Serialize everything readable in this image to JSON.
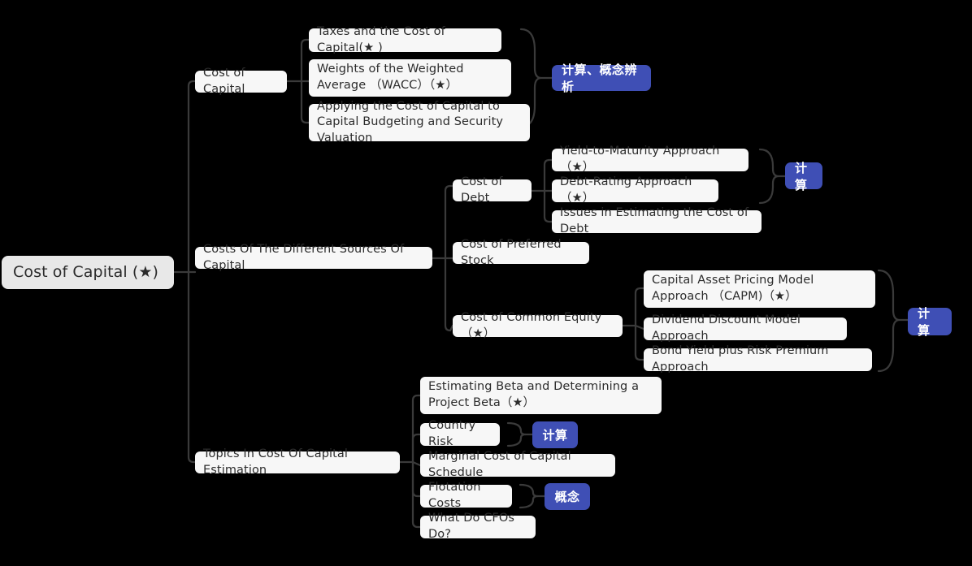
{
  "theme": {
    "background": "#000000",
    "node_bg": "#f7f7f7",
    "root_bg": "#e8e8e8",
    "text_color": "#2c2c2c",
    "badge_bg": "#3f4fb5",
    "badge_text": "#ffffff",
    "link_color": "#3a3a3a"
  },
  "root": {
    "label": "Cost of Capital (★)"
  },
  "branches": [
    {
      "label": "Cost of Capital",
      "children": [
        {
          "label": "Taxes and the Cost of Capital(★ )"
        },
        {
          "label": "Weights of the Weighted Average （WACC）（★）"
        },
        {
          "label": "Applying the Cost of Capital to Capital Budgeting and Security Valuation"
        }
      ],
      "badge": {
        "label": "计算、概念辨析",
        "covers": [
          0,
          1
        ]
      }
    },
    {
      "label": "Costs Of The Different Sources Of Capital",
      "children": [
        {
          "label": "Cost of Debt",
          "children": [
            {
              "label": "Yield-to-Maturity Approach （★）"
            },
            {
              "label": "Debt-Rating Approach （★）"
            },
            {
              "label": "Issues in Estimating the Cost of Debt"
            }
          ],
          "badge": {
            "label": "计算",
            "covers": [
              0,
              1
            ]
          }
        },
        {
          "label": "Cost of Preferred Stock"
        },
        {
          "label": "Cost of Common Equity（★）",
          "children": [
            {
              "label": "Capital Asset Pricing Model Approach （CAPM)（★）"
            },
            {
              "label": "Dividend Discount Model Approach"
            },
            {
              "label": "Bond Yield plus Risk Premium Approach"
            }
          ],
          "badge": {
            "label": "计算",
            "covers": [
              0,
              1,
              2
            ]
          }
        }
      ]
    },
    {
      "label": "Topics In Cost Of Capital Estimation",
      "children": [
        {
          "label": "Estimating Beta and Determining a Project Beta（★）"
        },
        {
          "label": "Country Risk",
          "badge": {
            "label": "计算"
          }
        },
        {
          "label": "Marginal Cost of Capital Schedule"
        },
        {
          "label": "Flotation Costs",
          "badge": {
            "label": "概念"
          }
        },
        {
          "label": "What Do CFOs Do?"
        }
      ]
    }
  ],
  "nodes": {
    "root": {
      "label": "Cost of Capital (★)"
    },
    "b1": {
      "label": "Cost of Capital"
    },
    "b1c1": {
      "label": "Taxes and the Cost of Capital(★ )"
    },
    "b1c2": {
      "label": "Weights of the Weighted Average （WACC）（★）"
    },
    "b1c3": {
      "label": "Applying the Cost of Capital to Capital Budgeting and Security Valuation"
    },
    "b1badge": {
      "label": "计算、概念辨析"
    },
    "b2": {
      "label": "Costs Of The Different Sources Of Capital"
    },
    "b2c1": {
      "label": "Cost of Debt"
    },
    "b2c1a": {
      "label": "Yield-to-Maturity Approach （★）"
    },
    "b2c1b": {
      "label": "Debt-Rating Approach （★）"
    },
    "b2c1c": {
      "label": "Issues in Estimating the Cost of Debt"
    },
    "b2c1badge": {
      "label": "计算"
    },
    "b2c2": {
      "label": "Cost of Preferred Stock"
    },
    "b2c3": {
      "label": "Cost of Common Equity（★）"
    },
    "b2c3a": {
      "label": "Capital Asset Pricing Model Approach （CAPM)（★）"
    },
    "b2c3b": {
      "label": "Dividend Discount Model Approach"
    },
    "b2c3c": {
      "label": "Bond Yield plus Risk Premium Approach"
    },
    "b2c3badge": {
      "label": "计算"
    },
    "b3": {
      "label": "Topics In Cost Of Capital Estimation"
    },
    "b3c1": {
      "label": "Estimating Beta and Determining a Project Beta（★）"
    },
    "b3c2": {
      "label": "Country Risk"
    },
    "b3c2badge": {
      "label": "计算"
    },
    "b3c3": {
      "label": "Marginal Cost of Capital Schedule"
    },
    "b3c4": {
      "label": "Flotation Costs"
    },
    "b3c4badge": {
      "label": "概念"
    },
    "b3c5": {
      "label": "What Do CFOs Do?"
    }
  }
}
